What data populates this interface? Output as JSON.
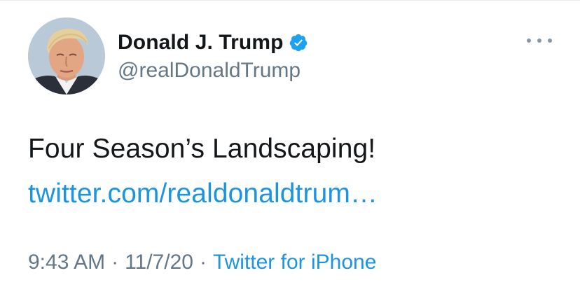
{
  "tweet": {
    "author": {
      "display_name": "Donald J. Trump",
      "handle": "@realDonaldTrump",
      "verified_icon": "verified-badge-icon",
      "avatar_icon": "profile-photo"
    },
    "text": "Four Season’s Landscaping!",
    "link": "twitter.com/realdonaldtrum…",
    "time": "9:43 AM",
    "separator": "·",
    "date": "11/7/20",
    "source": "Twitter for iPhone",
    "more_icon": "more-options-icon"
  },
  "colors": {
    "text_primary": "#14171a",
    "text_secondary": "#657786",
    "accent": "#1b95e0",
    "verified": "#1da1f2"
  }
}
